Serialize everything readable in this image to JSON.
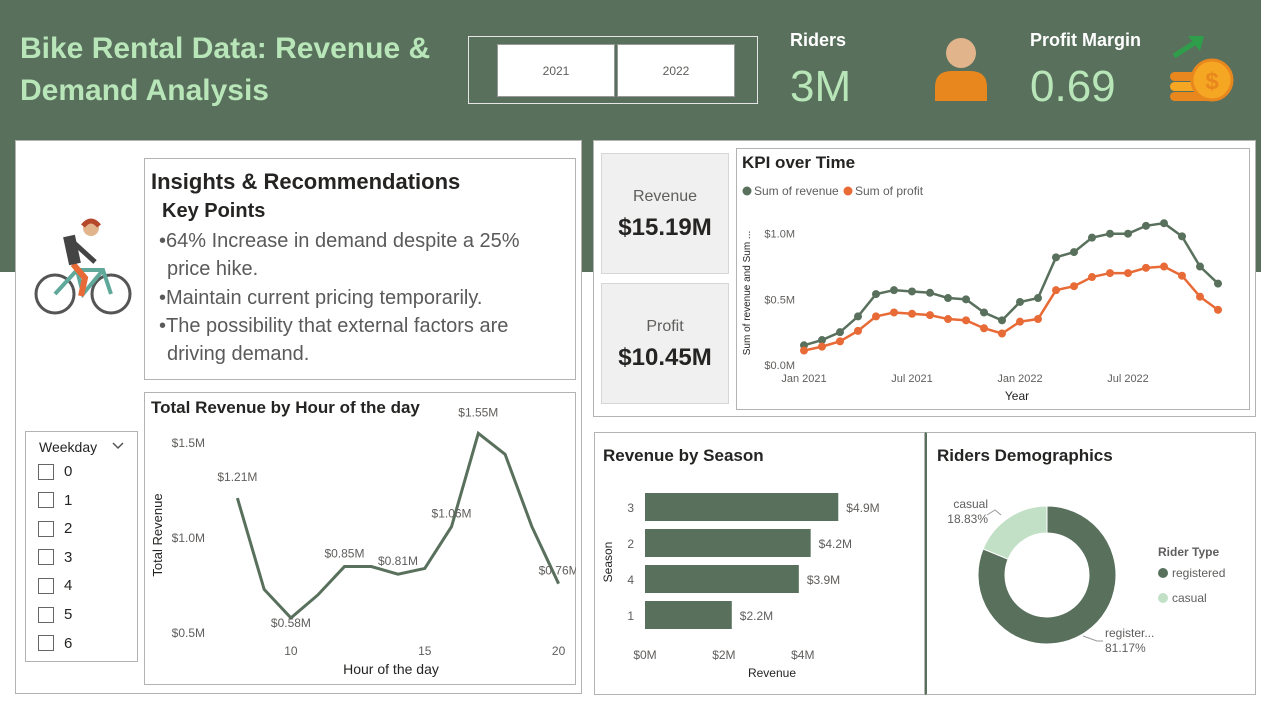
{
  "colors": {
    "header_bg": "#58705c",
    "title_text": "#b8e6b8",
    "kpi_value": "#b8e6b8",
    "revenue_line": "#58705c",
    "profit_line": "#e86a36",
    "bar": "#58705c",
    "casual": "#c2e0c6",
    "registered": "#58705c",
    "arrow": "#2e9e4a",
    "coin": "#f5a623"
  },
  "header": {
    "title": "Bike Rental Data: Revenue & Demand Analysis",
    "year_buttons": [
      "2021",
      "2022"
    ],
    "riders_label": "Riders",
    "riders_value": "3M",
    "profit_margin_label": "Profit Margin",
    "profit_margin_value": "0.69",
    "icons": [
      "person-icon",
      "coins-arrow-icon"
    ]
  },
  "insights": {
    "title": "Insights & Recommendations",
    "subtitle": "Key Points",
    "points": [
      "64% Increase in demand despite a 25% price hike.",
      "Maintain current pricing temporarily.",
      "The possibility that external factors are driving demand."
    ],
    "point_lines": [
      [
        "64% Increase in demand despite a 25%",
        "price hike."
      ],
      [
        "Maintain current pricing temporarily."
      ],
      [
        "The possibility that external factors are",
        "driving demand."
      ]
    ],
    "icon": "cyclist-icon"
  },
  "weekday_slicer": {
    "title": "Weekday",
    "options": [
      "0",
      "1",
      "2",
      "3",
      "4",
      "5",
      "6"
    ]
  },
  "cards": {
    "revenue_label": "Revenue",
    "revenue_value": "$15.19M",
    "profit_label": "Profit",
    "profit_value": "$10.45M"
  },
  "chart_data": [
    {
      "id": "kpi_over_time",
      "type": "line",
      "title": "KPI over Time",
      "xlabel": "Year",
      "ylabel": "Sum of revenue and Sum ...",
      "x": [
        "2021-01",
        "2021-02",
        "2021-03",
        "2021-04",
        "2021-05",
        "2021-06",
        "2021-07",
        "2021-08",
        "2021-09",
        "2021-10",
        "2021-11",
        "2021-12",
        "2022-01",
        "2022-02",
        "2022-03",
        "2022-04",
        "2022-05",
        "2022-06",
        "2022-07",
        "2022-08",
        "2022-09",
        "2022-10",
        "2022-11",
        "2022-12"
      ],
      "x_tick_labels": [
        "Jan 2021",
        "Jul 2021",
        "Jan 2022",
        "Jul 2022"
      ],
      "y_tick_labels": [
        "$0.0M",
        "$0.5M",
        "$1.0M"
      ],
      "ylim": [
        0,
        1.15
      ],
      "legend_position": "top-left",
      "series": [
        {
          "name": "Sum of revenue",
          "values": [
            0.15,
            0.19,
            0.25,
            0.37,
            0.54,
            0.57,
            0.56,
            0.55,
            0.51,
            0.5,
            0.4,
            0.34,
            0.48,
            0.51,
            0.82,
            0.86,
            0.97,
            1.0,
            1.0,
            1.06,
            1.08,
            0.98,
            0.75,
            0.62
          ]
        },
        {
          "name": "Sum of profit",
          "values": [
            0.11,
            0.14,
            0.18,
            0.26,
            0.37,
            0.4,
            0.39,
            0.38,
            0.35,
            0.34,
            0.28,
            0.24,
            0.33,
            0.35,
            0.57,
            0.6,
            0.67,
            0.7,
            0.7,
            0.74,
            0.75,
            0.68,
            0.52,
            0.42
          ]
        }
      ]
    },
    {
      "id": "revenue_by_hour",
      "type": "line",
      "title": "Total Revenue by Hour of the day",
      "xlabel": "Hour of the day",
      "ylabel": "Total Revenue",
      "x_ticks": [
        10,
        15,
        20
      ],
      "y_tick_labels": [
        "$0.5M",
        "$1.0M",
        "$1.5M"
      ],
      "xlim": [
        7.5,
        20.5
      ],
      "ylim": [
        0.38,
        1.62
      ],
      "x": [
        8,
        9,
        10,
        11,
        12,
        13,
        14,
        15,
        16,
        17,
        18,
        19,
        20
      ],
      "values": [
        1.21,
        0.73,
        0.58,
        0.7,
        0.85,
        0.85,
        0.81,
        0.84,
        1.06,
        1.55,
        1.44,
        1.06,
        0.76
      ],
      "data_labels": [
        "$1.21M",
        "",
        "$0.58M",
        "",
        "$0.85M",
        "",
        "$0.81M",
        "",
        "$1.06M",
        "$1.55M",
        "",
        "",
        "$0.76M"
      ]
    },
    {
      "id": "revenue_by_season",
      "type": "bar",
      "orientation": "horizontal",
      "title": "Revenue by Season",
      "xlabel": "Revenue",
      "ylabel": "Season",
      "categories": [
        "3",
        "2",
        "4",
        "1"
      ],
      "values": [
        4.9,
        4.2,
        3.9,
        2.2
      ],
      "data_labels": [
        "$4.9M",
        "$4.2M",
        "$3.9M",
        "$2.2M"
      ],
      "x_tick_labels": [
        "$0M",
        "$2M",
        "$4M"
      ],
      "xlim": [
        0,
        5.4
      ]
    },
    {
      "id": "riders_demographics",
      "type": "pie",
      "title": "Riders Demographics",
      "legend_title": "Rider Type",
      "legend_position": "right",
      "categories": [
        "registered",
        "casual"
      ],
      "values": [
        81.17,
        18.83
      ],
      "data_labels": [
        [
          "register...",
          "81.17%"
        ],
        [
          "casual",
          "18.83%"
        ]
      ]
    }
  ]
}
